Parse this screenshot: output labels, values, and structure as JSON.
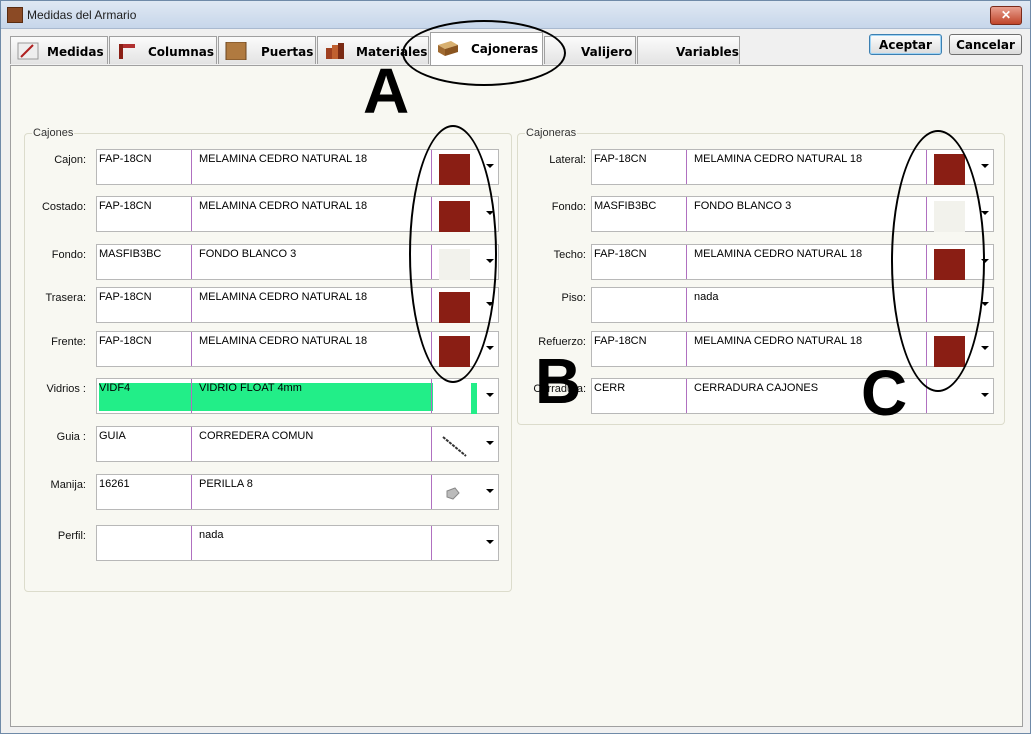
{
  "window": {
    "title": "Medidas del Armario",
    "close_label": "✕"
  },
  "tabs": [
    {
      "label": "Medidas"
    },
    {
      "label": "Columnas"
    },
    {
      "label": "Puertas"
    },
    {
      "label": "Materiales"
    },
    {
      "label": "Cajoneras"
    },
    {
      "label": "Valijero"
    },
    {
      "label": "Variables"
    }
  ],
  "active_tab": "Cajoneras",
  "buttons": {
    "accept": "Aceptar",
    "cancel": "Cancelar"
  },
  "cajones": {
    "title": "Cajones",
    "rows": [
      {
        "label": "Cajon:",
        "code": "FAP-18CN",
        "desc": "MELAMINA CEDRO NATURAL 18",
        "swatch": "cedro-swatch"
      },
      {
        "label": "Costado:",
        "code": "FAP-18CN",
        "desc": "MELAMINA CEDRO NATURAL 18",
        "swatch": "cedro-swatch"
      },
      {
        "label": "Fondo:",
        "code": "MASFIB3BC",
        "desc": "FONDO BLANCO 3",
        "swatch": "white-swatch"
      },
      {
        "label": "Trasera:",
        "code": "FAP-18CN",
        "desc": "MELAMINA CEDRO NATURAL 18",
        "swatch": "cedro-swatch"
      },
      {
        "label": "Frente:",
        "code": "FAP-18CN",
        "desc": "MELAMINA CEDRO NATURAL 18",
        "swatch": "cedro-swatch"
      },
      {
        "label": "Vidrios :",
        "code": "VIDF4",
        "desc": "VIDRIO FLOAT 4mm",
        "swatch": "green-fill"
      },
      {
        "label": "Guia :",
        "code": "GUIA",
        "desc": "CORREDERA COMUN",
        "swatch": "rail-icon"
      },
      {
        "label": "Manija:",
        "code": "16261",
        "desc": "PERILLA 8",
        "swatch": "knob-icon"
      },
      {
        "label": "Perfil:",
        "code": "",
        "desc": "nada",
        "swatch": "none"
      }
    ]
  },
  "cajoneras": {
    "title": "Cajoneras",
    "rows": [
      {
        "label": "Lateral:",
        "code": "FAP-18CN",
        "desc": "MELAMINA CEDRO NATURAL 18",
        "swatch": "cedro-swatch"
      },
      {
        "label": "Fondo:",
        "code": "MASFIB3BC",
        "desc": "FONDO BLANCO 3",
        "swatch": "white-swatch"
      },
      {
        "label": "Techo:",
        "code": "FAP-18CN",
        "desc": "MELAMINA CEDRO NATURAL 18",
        "swatch": "cedro-swatch"
      },
      {
        "label": "Piso:",
        "code": "",
        "desc": "nada",
        "swatch": "none"
      },
      {
        "label": "Refuerzo:",
        "code": "FAP-18CN",
        "desc": "MELAMINA CEDRO NATURAL 18",
        "swatch": "cedro-swatch"
      },
      {
        "label": "Cerradura:",
        "code": "CERR",
        "desc": "CERRADURA CAJONES",
        "swatch": "none"
      }
    ]
  },
  "annotations": {
    "a": "A",
    "b": "B",
    "c": "C"
  },
  "colors": {
    "cedro": "#8a1e14",
    "green": "#22ee88",
    "page_bg": "#f8f8f2"
  }
}
